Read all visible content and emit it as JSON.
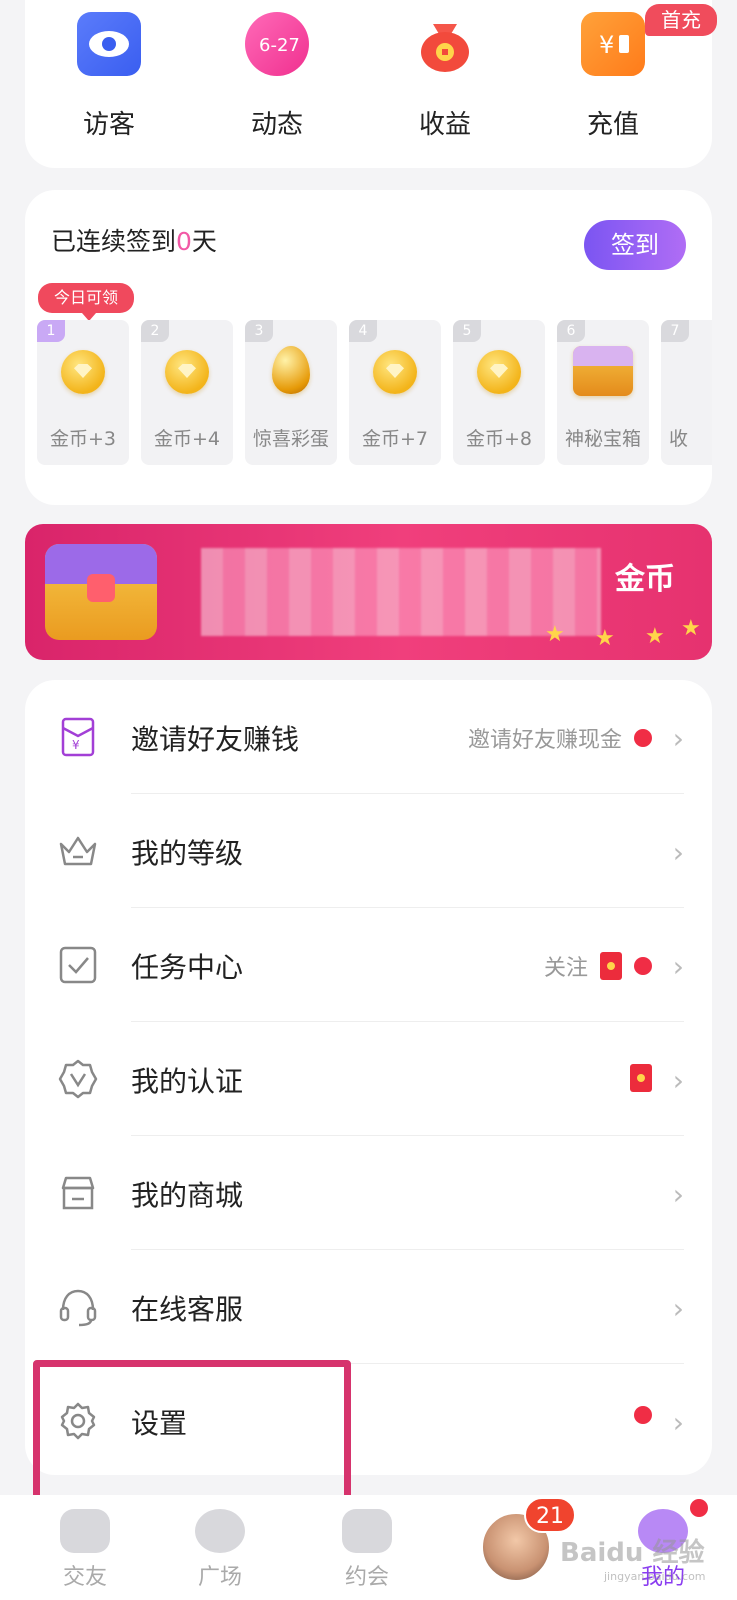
{
  "quick": {
    "items": [
      {
        "label": "访客",
        "icon": "eye-icon"
      },
      {
        "label": "动态",
        "icon": "calendar-icon"
      },
      {
        "label": "收益",
        "icon": "money-bag-icon"
      },
      {
        "label": "充值",
        "icon": "wallet-icon"
      }
    ],
    "first_badge": "首充"
  },
  "sign": {
    "title_prefix": "已连续签到",
    "days_count": "0",
    "title_suffix": "天",
    "button": "签到",
    "today_tag": "今日可领",
    "days": [
      {
        "num": "1",
        "label": "金币+3"
      },
      {
        "num": "2",
        "label": "金币+4"
      },
      {
        "num": "3",
        "label": "惊喜彩蛋"
      },
      {
        "num": "4",
        "label": "金币+7"
      },
      {
        "num": "5",
        "label": "金币+8"
      },
      {
        "num": "6",
        "label": "神秘宝箱"
      },
      {
        "num": "7",
        "label": "收"
      }
    ]
  },
  "banner": {
    "text_end": "金币"
  },
  "menu": {
    "invite": {
      "label": "邀请好友赚钱",
      "right": "邀请好友赚现金"
    },
    "level": {
      "label": "我的等级"
    },
    "task": {
      "label": "任务中心",
      "right": "关注"
    },
    "auth": {
      "label": "我的认证"
    },
    "mall": {
      "label": "我的商城"
    },
    "service": {
      "label": "在线客服"
    },
    "settings": {
      "label": "设置"
    }
  },
  "nav": {
    "friends": "交友",
    "square": "广场",
    "date": "约会",
    "mine": "我的",
    "unread": "21"
  },
  "watermark": {
    "main": "Baidu 经验",
    "sub": "jingyan.baidu.com"
  },
  "colors": {
    "accent": "#8a3df0",
    "red": "#f02d45",
    "banner": "#e6326f"
  }
}
